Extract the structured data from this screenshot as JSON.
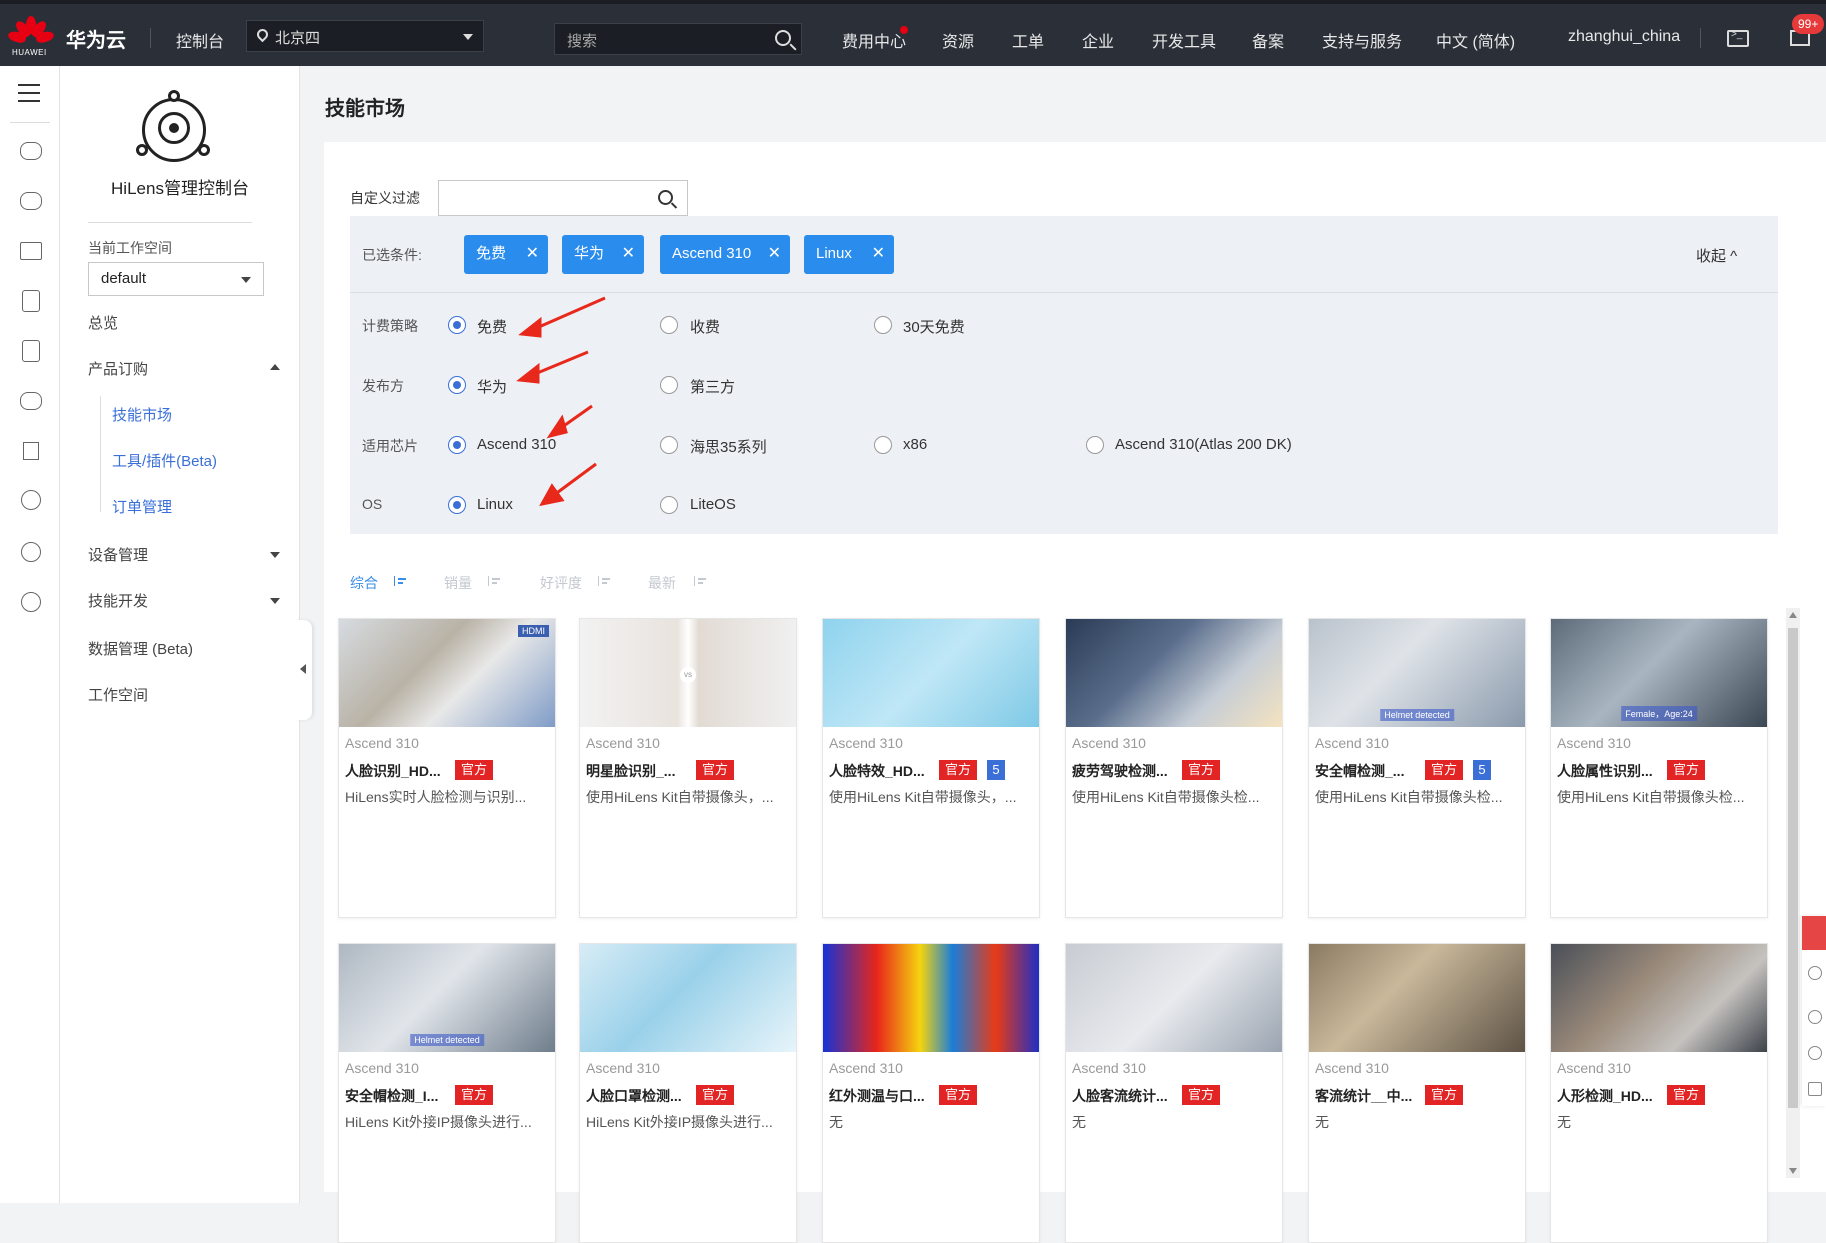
{
  "topnav": {
    "brand": "华为云",
    "brand_sub": "HUAWEI",
    "console": "控制台",
    "region": "北京四",
    "search_placeholder": "搜索",
    "items": [
      "费用中心",
      "资源",
      "工单",
      "企业",
      "开发工具",
      "备案",
      "支持与服务",
      "中文 (简体)",
      "zhanghui_china"
    ],
    "mail_badge": "99+"
  },
  "sidebar": {
    "console_title": "HiLens管理控制台",
    "workspace_label": "当前工作空间",
    "workspace_value": "default",
    "overview": "总览",
    "product_order": "产品订购",
    "sub_items": [
      "技能市场",
      "工具/插件(Beta)",
      "订单管理"
    ],
    "device_mgmt": "设备管理",
    "skill_dev": "技能开发",
    "data_mgmt": "数据管理 (Beta)",
    "workspace": "工作空间"
  },
  "main": {
    "title": "技能市场",
    "filter_label": "自定义过滤",
    "selected_label": "已选条件:",
    "chips": [
      "免费",
      "华为",
      "Ascend 310",
      "Linux"
    ],
    "collapse": "收起",
    "rows": [
      {
        "label": "计费策略",
        "options": [
          "免费",
          "收费",
          "30天免费"
        ],
        "selected": 0
      },
      {
        "label": "发布方",
        "options": [
          "华为",
          "第三方"
        ],
        "selected": 0
      },
      {
        "label": "适用芯片",
        "options": [
          "Ascend 310",
          "海思35系列",
          "x86",
          "Ascend 310(Atlas 200 DK)"
        ],
        "selected": 0
      },
      {
        "label": "OS",
        "options": [
          "Linux",
          "LiteOS"
        ],
        "selected": 0
      }
    ],
    "sort": [
      "综合",
      "销量",
      "好评度",
      "最新"
    ],
    "sort_active": 0
  },
  "cards": [
    {
      "chip": "Ascend 310",
      "title": "人脸识别_HD...",
      "tag": "官方",
      "num": "",
      "desc": "HiLens实时人脸检测与识别...",
      "img": "HDMI"
    },
    {
      "chip": "Ascend 310",
      "title": "明星脸识别_...",
      "tag": "官方",
      "num": "",
      "desc": "使用HiLens Kit自带摄像头，...",
      "img": "vs"
    },
    {
      "chip": "Ascend 310",
      "title": "人脸特效_HD...",
      "tag": "官方",
      "num": "5",
      "desc": "使用HiLens Kit自带摄像头，...",
      "img": ""
    },
    {
      "chip": "Ascend 310",
      "title": "疲劳驾驶检测...",
      "tag": "官方",
      "num": "",
      "desc": "使用HiLens Kit自带摄像头检...",
      "img": ""
    },
    {
      "chip": "Ascend 310",
      "title": "安全帽检测_...",
      "tag": "官方",
      "num": "5",
      "desc": "使用HiLens Kit自带摄像头检...",
      "img": "Helmet detected"
    },
    {
      "chip": "Ascend 310",
      "title": "人脸属性识别...",
      "tag": "官方",
      "num": "",
      "desc": "使用HiLens Kit自带摄像头检...",
      "img": "Female，Age:24"
    },
    {
      "chip": "Ascend 310",
      "title": "安全帽检测_I...",
      "tag": "官方",
      "num": "",
      "desc": "HiLens Kit外接IP摄像头进行...",
      "img": "Helmet detected"
    },
    {
      "chip": "Ascend 310",
      "title": "人脸口罩检测...",
      "tag": "官方",
      "num": "",
      "desc": "HiLens Kit外接IP摄像头进行...",
      "img": ""
    },
    {
      "chip": "Ascend 310",
      "title": "红外测温与口...",
      "tag": "官方",
      "num": "",
      "desc": "无",
      "img": ""
    },
    {
      "chip": "Ascend 310",
      "title": "人脸客流统计...",
      "tag": "官方",
      "num": "",
      "desc": "无",
      "img": ""
    },
    {
      "chip": "Ascend 310",
      "title": "客流统计__中...",
      "tag": "官方",
      "num": "",
      "desc": "无",
      "img": ""
    },
    {
      "chip": "Ascend 310",
      "title": "人形检测_HD...",
      "tag": "官方",
      "num": "",
      "desc": "无",
      "img": ""
    }
  ],
  "colors": {
    "accent": "#2a8cec",
    "tag_red": "#e22424",
    "nav_bg": "#2a2f38"
  }
}
